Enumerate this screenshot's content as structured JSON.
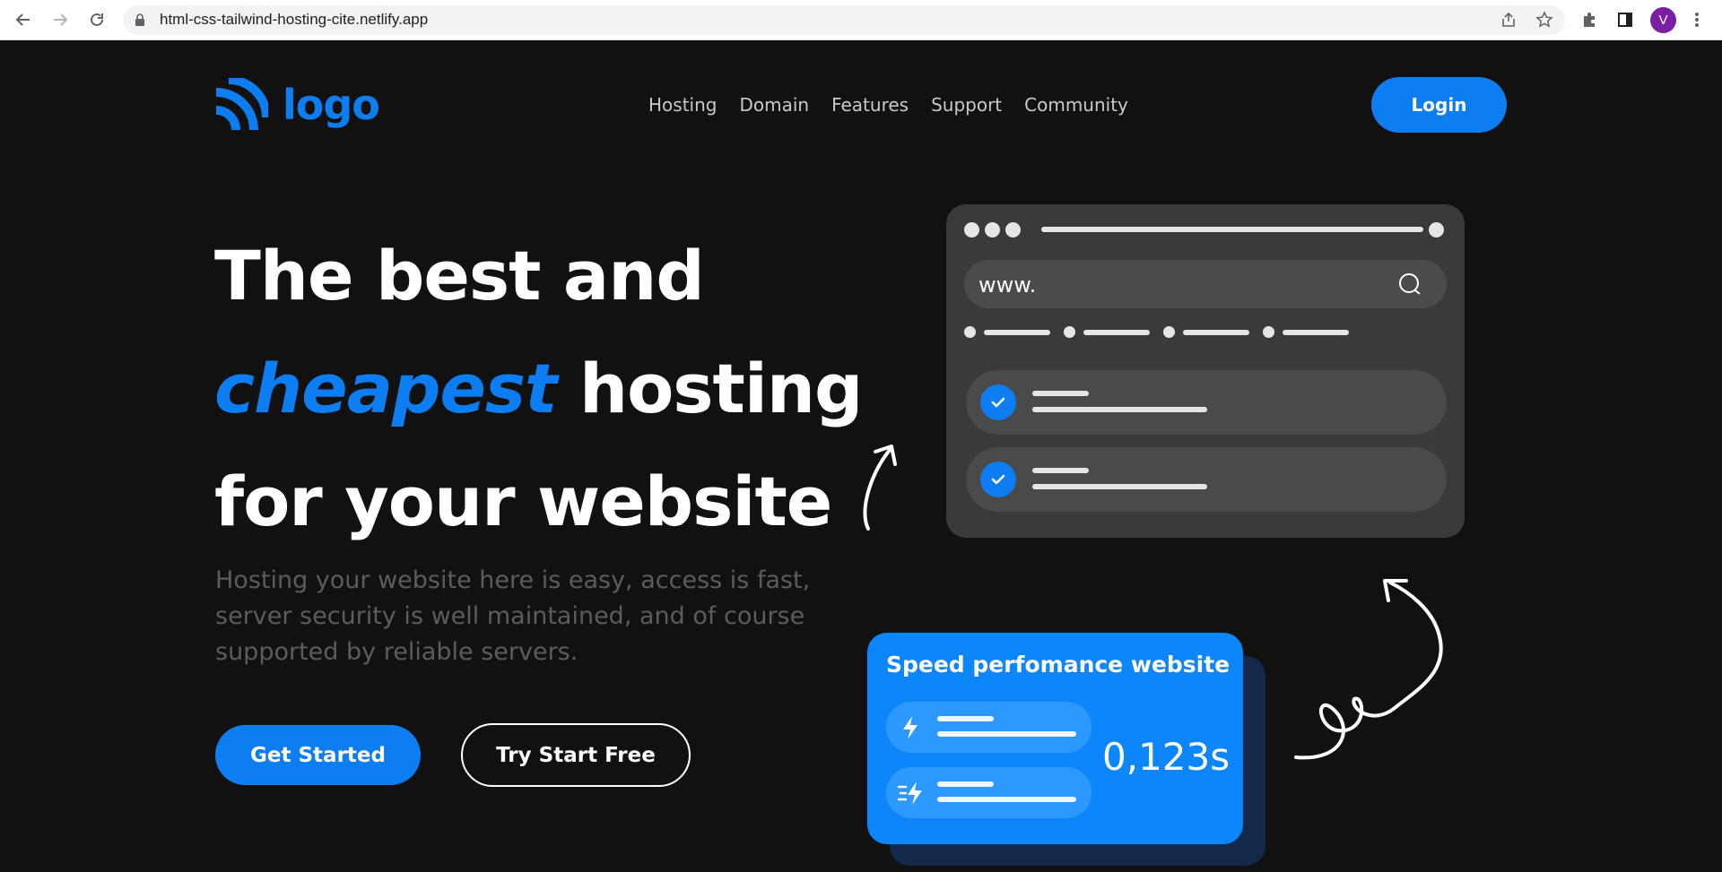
{
  "browser": {
    "url": "html-css-tailwind-hosting-cite.netlify.app",
    "avatar_letter": "V"
  },
  "header": {
    "logo_text": "logo",
    "nav": [
      "Hosting",
      "Domain",
      "Features",
      "Support",
      "Community"
    ],
    "login_label": "Login"
  },
  "hero": {
    "line1": "The best and",
    "line2_accent": "cheapest",
    "line2_rest": " hosting",
    "line3": "for your website",
    "description": "Hosting your website here is easy, access is fast, server security is well maintained, and of course supported by reliable servers.",
    "cta_primary": "Get Started",
    "cta_secondary": "Try Start Free"
  },
  "mock_browser": {
    "search_text": "www."
  },
  "speed_card": {
    "title": "Speed perfomance website",
    "value": "0,123s"
  },
  "colors": {
    "accent": "#0d7ef2",
    "background": "#111111",
    "card": "#3a3a3a"
  }
}
